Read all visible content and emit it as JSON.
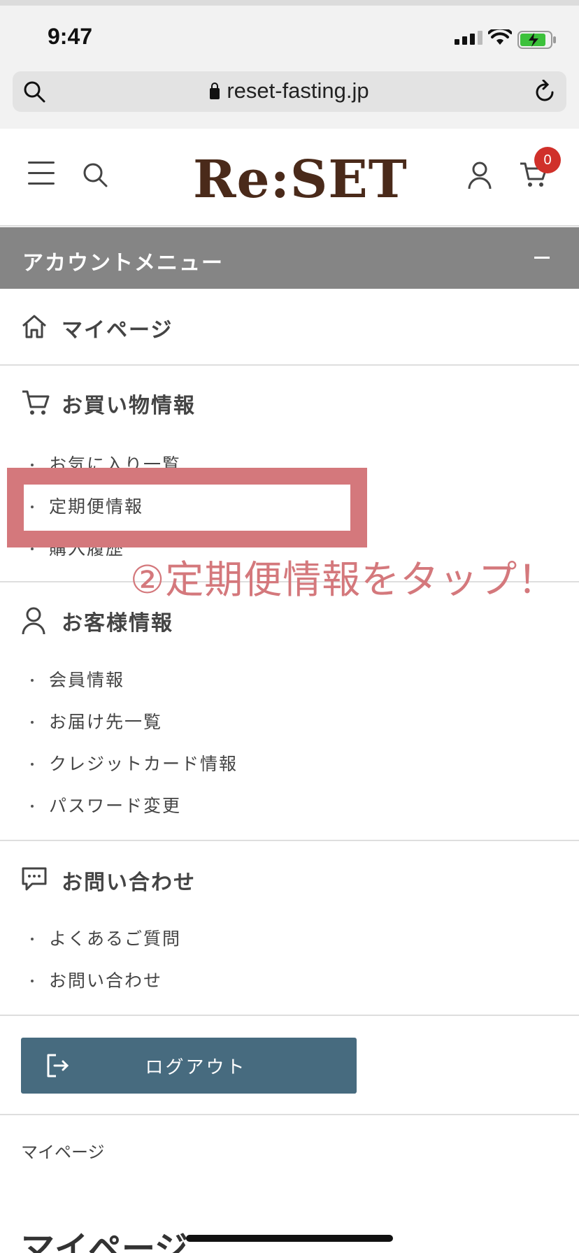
{
  "status": {
    "time": "9:47"
  },
  "browser": {
    "url": "reset-fasting.jp"
  },
  "header": {
    "logo": "Re:SET",
    "cart_count": "0"
  },
  "account_menu": {
    "title": "アカウントメニュー",
    "mypage_label": "マイページ",
    "shopping": {
      "title": "お買い物情報",
      "items": [
        "お気に入り一覧",
        "定期便情報",
        "購入履歴"
      ]
    },
    "customer": {
      "title": "お客様情報",
      "items": [
        "会員情報",
        "お届け先一覧",
        "クレジットカード情報",
        "パスワード変更"
      ]
    },
    "contact": {
      "title": "お問い合わせ",
      "items": [
        "よくあるご質問",
        "お問い合わせ"
      ]
    },
    "logout_label": "ログアウト"
  },
  "annotation": {
    "text": "②定期便情報をタップ！"
  },
  "breadcrumb": "マイページ",
  "page_title": "マイページ",
  "colors": {
    "accent_brand": "#4a2a1a",
    "logout_bg": "#476b7f",
    "highlight": "#d4787c",
    "badge": "#d0302a"
  }
}
